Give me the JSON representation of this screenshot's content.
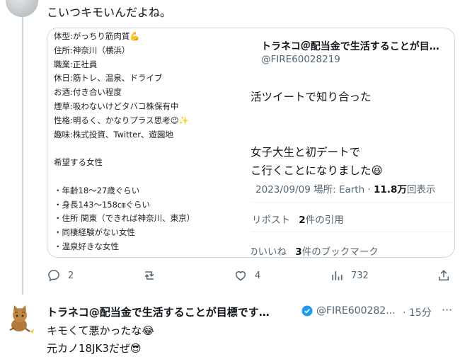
{
  "top_tweet": {
    "text": "こいつキモいんだよね。"
  },
  "quote": {
    "profile_lines": [
      "体型:がっちり筋肉質💪",
      "住所:神奈川（横浜）",
      "職業:正社員",
      "休日:筋トレ、温泉、ドライブ",
      "お酒:付き合い程度",
      "煙草:吸わないけどタバコ株保有中",
      "性格:明るく、かなりプラス思考😉✨",
      "趣味:株式投資、Twitter、遊園地",
      "",
      "希望する女性",
      "",
      "・年齢18〜27歳ぐらい",
      "・身長143〜158㎝ぐらい",
      "・住所 関東（できれば神奈川、東京）",
      "・同棲経験がない女性",
      "・温泉好きな女性"
    ],
    "author_name": "トラネコ＠配当金で生活することが目…",
    "author_handle": "@FIRE60028219",
    "body_lines": [
      "活ツイートで知り合った",
      "",
      "",
      "女子大生と初デートで",
      "こ行くことになりました😆"
    ],
    "timestamp": "2023/09/09 場所: Earth ·",
    "views_count": "11.8万",
    "views_label": "回表示",
    "reposts_label": "リポスト",
    "quotes_count": "2",
    "quotes_label": "件の引用",
    "likes_label": "のいいね",
    "bookmarks_count": "3",
    "bookmarks_label": "件のブックマーク"
  },
  "actions": {
    "replies": "2",
    "reposts": "",
    "likes": "4",
    "views": "732"
  },
  "reply": {
    "author_name": "トラネコ@配当金で生活することが目標です…",
    "handle": "@FIRE600282...",
    "time": "· 15分",
    "more": "···",
    "lines": [
      "キモくて悪かったな😂",
      "元カノ18JK3だぜ😎"
    ]
  },
  "colors": {
    "text": "#0f1419",
    "muted": "#536471",
    "border": "#cfd9de",
    "verified": "#1d9bf0"
  },
  "icons": [
    "reply-icon",
    "repost-icon",
    "like-icon",
    "views-icon",
    "share-icon",
    "verified-icon",
    "more-icon"
  ]
}
